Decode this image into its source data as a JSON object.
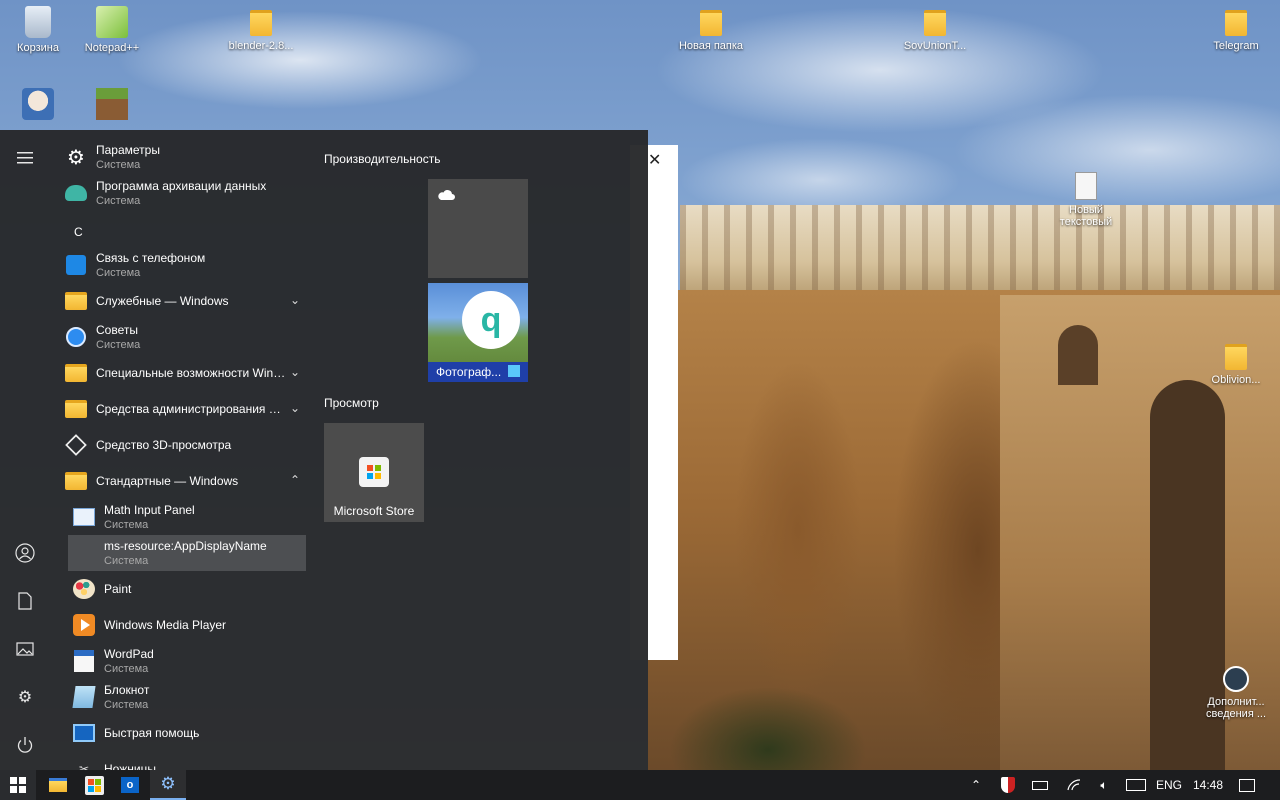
{
  "desktop": {
    "icons": [
      {
        "label": "Корзина",
        "icon": "recycle-bin-icon"
      },
      {
        "label": "Notepad++",
        "icon": "notepad-plus-plus-icon"
      },
      {
        "label": "blender-2.8...",
        "icon": "folder-icon"
      },
      {
        "label": "Новая папка",
        "icon": "folder-icon"
      },
      {
        "label": "SovUnionT...",
        "icon": "folder-icon"
      },
      {
        "label": "Telegram",
        "icon": "folder-icon"
      },
      {
        "label": "Новый текстовый",
        "icon": "text-document-icon"
      },
      {
        "label": "Oblivion...",
        "icon": "folder-icon"
      },
      {
        "label": "Дополнит... сведения ...",
        "icon": "shield-icon"
      }
    ]
  },
  "start_menu": {
    "rail": {
      "expand": "hamburger-icon",
      "account": "user-icon",
      "documents": "document-icon",
      "pictures": "pictures-icon",
      "settings": "gear-icon",
      "power": "power-icon"
    },
    "app_list": {
      "items": [
        {
          "name": "Параметры",
          "sub": "Система"
        },
        {
          "name": "Программа архивации данных",
          "sub": "Система"
        },
        {
          "letter": "С"
        },
        {
          "name": "Связь с телефоном",
          "sub": "Система"
        },
        {
          "name": "Служебные — Windows"
        },
        {
          "name": "Советы",
          "sub": "Система"
        },
        {
          "name": "Специальные возможности Windows"
        },
        {
          "name": "Средства администрирования Windows"
        },
        {
          "name": "Средство 3D-просмотра"
        },
        {
          "name": "Стандартные — Windows"
        },
        {
          "name": "Math Input Panel",
          "sub": "Система"
        },
        {
          "name": "ms-resource:AppDisplayName",
          "sub": "Система"
        },
        {
          "name": "Paint"
        },
        {
          "name": "Windows Media Player"
        },
        {
          "name": "WordPad",
          "sub": "Система"
        },
        {
          "name": "Блокнот",
          "sub": "Система"
        },
        {
          "name": "Быстрая помощь"
        },
        {
          "name": "Ножницы"
        }
      ]
    },
    "tiles": {
      "group_productivity": "Производительность",
      "group_browse": "Просмотр",
      "photos_label": "Фотограф...",
      "store_label": "Microsoft Store"
    }
  },
  "taskbar": {
    "language": "ENG",
    "time": "14:48"
  },
  "colors": {
    "menu_bg": "#26282a",
    "taskbar_bg": "#1c1d1f",
    "accent": "#7ab0f0",
    "folder": "#f2b632"
  }
}
